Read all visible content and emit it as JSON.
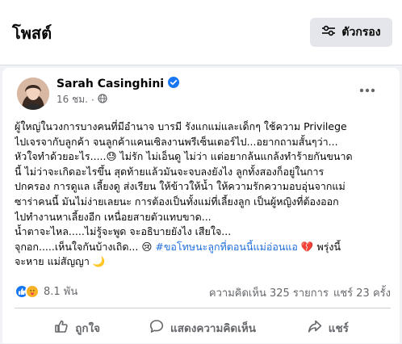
{
  "header": {
    "title": "โพสต์",
    "filter_label": "ตัวกรอง"
  },
  "post": {
    "author": "Sarah Casinghini",
    "time": "16 ชม.",
    "body_lines": [
      "ผู้ใหญ่ในวงการบางคนที่มีอำนาจ บารมี รังแกแม่และเด็กๆ ใช้ความ Privilege",
      "ไปเจรจากับลูกค้า จนลูกค้าแคนเซิลงานพรีเซ็นเตอร์ไป...อยากถามสั้นๆว่า...",
      "หัวใจทำด้วยอะไร.....😓 ไม่รัก ไม่เอ็นดู ไม่ว่า แต่อยากล้นแกล้งทำร้ายกันขนาด",
      "นี้ ไม่ว่าจะเกิดอะไรขึ้น สุดท้ายแล้วมันจะจบลงยังไง ลูกทั้งสองก็อยู่ในการ",
      "ปกครอง การดูแล เลี้ยงดู ส่งเรียน ให้ข้าวให้น้ำ ให้ความรักความอบอุ่นจากแม่",
      "ซาร่าคนนี้ มันไม่ง่ายเลยนะ การต้องเป็นทั้งแม่ที่เลี้ยงลูก เป็นผู้หญิงที่ต้องออก",
      "ไปทำงานหาเลี้ยงอีก เหนื่อยสายตัวแทบขาด...",
      "น้ำตาจะไหล.....ไม่รู้จะพูด จะอธิบายยังไง เสียใจ..."
    ],
    "line9_prefix": "จุกอก.....เห็นใจกันบ้างเถิด... 😢 ",
    "hashtag": "#ขอโทษนะลูกที่ตอนนี้แม่อ่อนแอ",
    "line9_suffix": " 💔 พรุ่งนี้",
    "line10": "จะหาย แม่สัญญา 🌙"
  },
  "stats": {
    "reaction_count": "8.1 พัน",
    "comments": "ความคิดเห็น 325 รายการ",
    "shares": "แชร์ 23 ครั้ง"
  },
  "actions": {
    "like": "ถูกใจ",
    "comment": "แสดงความคิดเห็น",
    "share": "แชร์"
  },
  "colors": {
    "accent": "#1877f2",
    "hashtag": "#216fdb",
    "muted": "#65676b",
    "love": "#f33e58",
    "care": "#f7b125"
  },
  "icons": {
    "filter": "sliders-icon",
    "verified": "verified-badge-icon",
    "audience": "globe-icon",
    "more": "more-horizontal-icon",
    "like_reaction": "like-reaction-icon",
    "care_reaction": "care-reaction-icon",
    "like_action": "thumbs-up-icon",
    "comment_action": "comment-bubble-icon",
    "share_action": "share-arrow-icon"
  }
}
